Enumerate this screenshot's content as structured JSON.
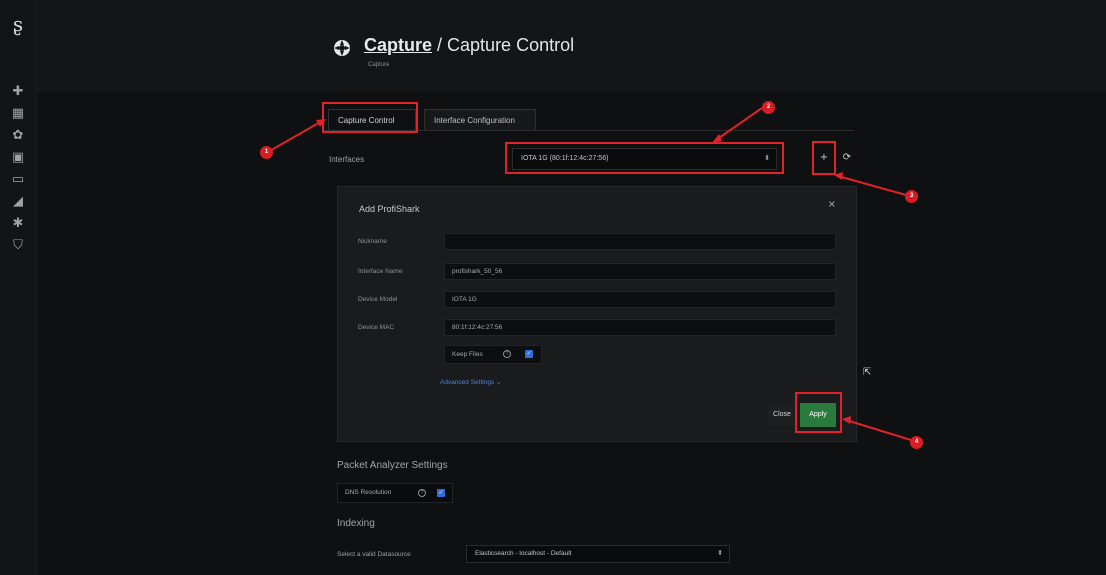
{
  "header": {
    "crumb": "Capture",
    "separator": " / ",
    "title": "Capture Control",
    "subtitle": "Capture"
  },
  "tabs": [
    {
      "label": "Capture Control",
      "active": true
    },
    {
      "label": "Interface Configuration",
      "active": false
    }
  ],
  "interfaces": {
    "label": "Interfaces",
    "selected": "IOTA 1G (80:1f:12:4c:27:56)",
    "add_icon": "plus-icon",
    "refresh_icon": "refresh-icon"
  },
  "modal": {
    "title": "Add ProfiShark",
    "close_glyph": "×",
    "fields": [
      {
        "label": "Nickname",
        "value": ""
      },
      {
        "label": "Interface Name",
        "value": "profishark_50_56"
      },
      {
        "label": "Device Model",
        "value": "IOTA 1G"
      },
      {
        "label": "Device MAC",
        "value": "80:1f:12:4c:27:56"
      }
    ],
    "keep_files": {
      "label": "Keep Files",
      "checked": true
    },
    "advanced": "Advanced Settings ⌄",
    "close_label": "Close",
    "apply_label": "Apply"
  },
  "packet_analyzer": {
    "heading": "Packet Analyzer Settings",
    "dns_label": "DNS Resolution",
    "dns_checked": true
  },
  "indexing": {
    "heading": "Indexing",
    "datasource_label": "Select a valid Datasource",
    "datasource_value": "Elasticsearch - localhost - Default"
  },
  "annotations": [
    "1",
    "2",
    "3",
    "4"
  ],
  "colors": {
    "accent_red": "#e0232a",
    "apply_green": "#2a7a3e",
    "checkbox_blue": "#2f6fd6",
    "link_blue": "#4a86d8"
  }
}
